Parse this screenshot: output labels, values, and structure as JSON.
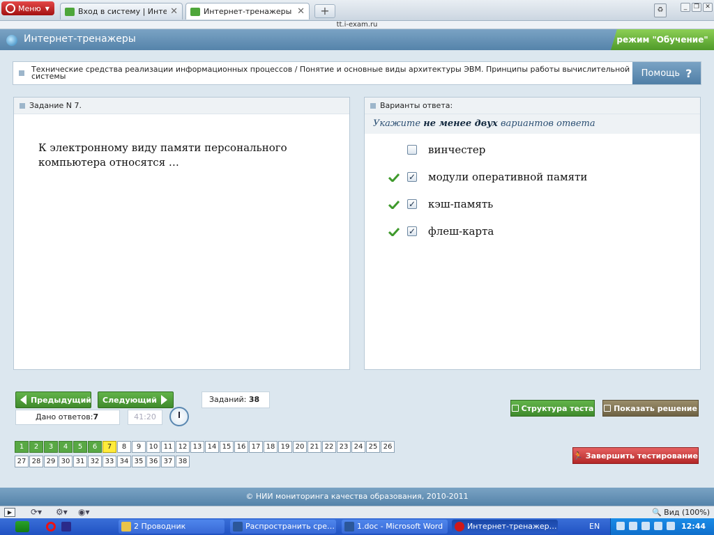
{
  "browser": {
    "menu_label": "Меню",
    "tabs": [
      {
        "label": "Вход в систему | Интер…"
      },
      {
        "label": "Интернет-тренажеры"
      }
    ],
    "new_tab_label": "+",
    "url": "tt.i-exam.ru"
  },
  "header": {
    "title": "Интернет-тренажеры",
    "mode": "режим \"Обучение\""
  },
  "breadcrumb": {
    "text": "Технические средства реализации информационных процессов / Понятие и основные виды архитектуры ЭВМ. Принципы работы вычислительной системы",
    "help_label": "Помощь",
    "help_glyph": "?"
  },
  "task_panel": {
    "title": "Задание N 7.",
    "question": "К электронному виду памяти персонального компьютера относятся …"
  },
  "answer_panel": {
    "title": "Варианты ответа:",
    "instruction_pre": "Укажите",
    "instruction_bold": "не менее двух",
    "instruction_post": "вариантов ответа",
    "options": [
      {
        "label": "винчестер",
        "checked": false,
        "correct": false
      },
      {
        "label": "модули оперативной памяти",
        "checked": true,
        "correct": true
      },
      {
        "label": "кэш-память",
        "checked": true,
        "correct": true
      },
      {
        "label": "флеш-карта",
        "checked": true,
        "correct": true
      }
    ]
  },
  "controls": {
    "prev_label": "Предыдущий",
    "next_label": "Следующий",
    "answered_label": "Дано ответов:",
    "answered_value": "7",
    "timer": "41:20",
    "tasks_label": "Заданий:",
    "tasks_value": "38",
    "structure_label": "Структура теста",
    "solution_label": "Показать решение",
    "finish_label": "Завершить тестирование"
  },
  "task_grid": {
    "current": 7,
    "completed": [
      1,
      2,
      3,
      4,
      5,
      6
    ],
    "numbers": [
      "1",
      "2",
      "3",
      "4",
      "5",
      "6",
      "7",
      "8",
      "9",
      "10",
      "11",
      "12",
      "13",
      "14",
      "15",
      "16",
      "17",
      "18",
      "19",
      "20",
      "21",
      "22",
      "23",
      "24",
      "25",
      "26",
      "27",
      "28",
      "29",
      "30",
      "31",
      "32",
      "33",
      "34",
      "35",
      "36",
      "37",
      "38"
    ]
  },
  "footer": {
    "text": "© НИИ мониторинга качества образования, 2010-2011"
  },
  "statusbar": {
    "zoom_label": "Вид (100%)"
  },
  "taskbar": {
    "items": [
      {
        "label": "2 Проводник"
      },
      {
        "label": "Распространить сре…"
      },
      {
        "label": "1.doc - Microsoft Word"
      },
      {
        "label": "Интернет-тренажер…"
      }
    ],
    "language": "EN",
    "clock": "12:44"
  },
  "colors": {
    "accent_blue": "#5583aa",
    "done_green": "#58a844",
    "current_yellow": "#ffeb3b",
    "finish_red": "#b32727"
  }
}
